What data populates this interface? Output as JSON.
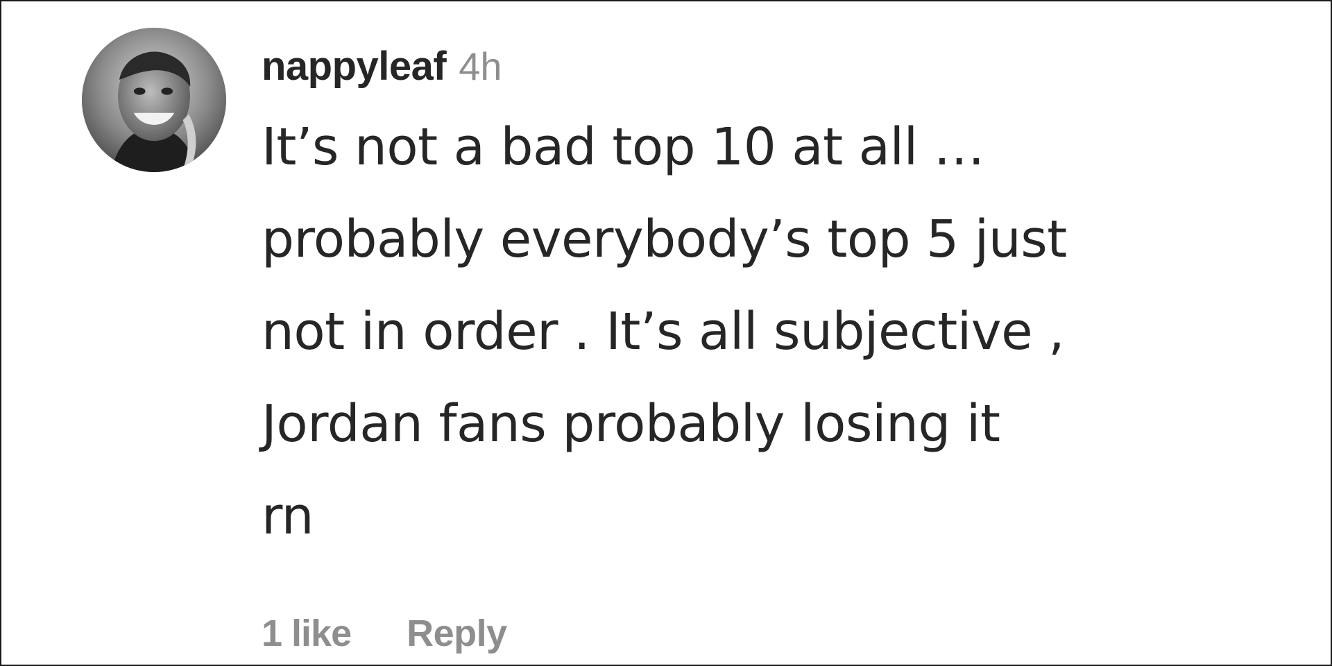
{
  "comment": {
    "avatar_icon": "profile-avatar",
    "username": "nappyleaf",
    "time": "4h",
    "text_lines": [
      "It’s not a bad top 10 at all …",
      "probably everybody’s top 5 just",
      "not in order . It’s all subjective ,",
      "Jordan fans probably losing it",
      "rn"
    ],
    "likes": "1 like",
    "reply_label": "Reply"
  },
  "colors": {
    "text": "#262626",
    "muted": "#8e8e8e"
  }
}
